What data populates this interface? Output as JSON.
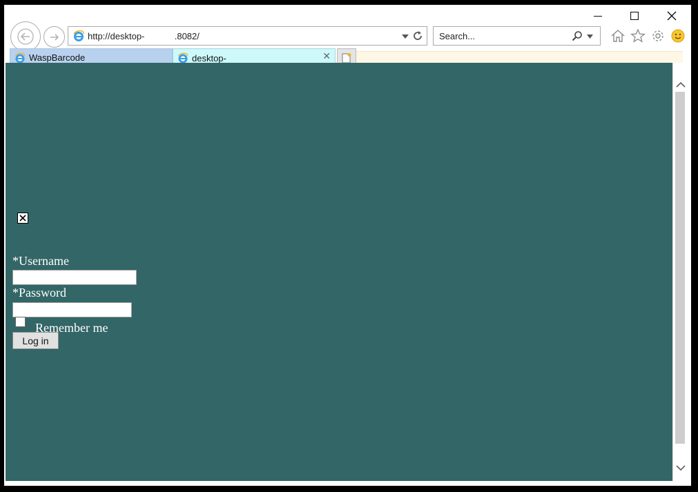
{
  "window": {
    "minimize_icon": "minimize-icon",
    "maximize_icon": "maximize-icon",
    "close_icon": "close-icon"
  },
  "nav": {
    "address": "http://desktop-            .8082/",
    "search_placeholder": "Search..."
  },
  "tabs": [
    {
      "label": "WaspBarcode",
      "active": false
    },
    {
      "label": "desktop-",
      "active": true
    }
  ],
  "page": {
    "background": "#336666",
    "username_label": "*Username",
    "username_value": "",
    "password_label": "*Password",
    "password_value": "",
    "remember_label": "Remember me",
    "remember_checked": false,
    "login_label": "Log in"
  }
}
